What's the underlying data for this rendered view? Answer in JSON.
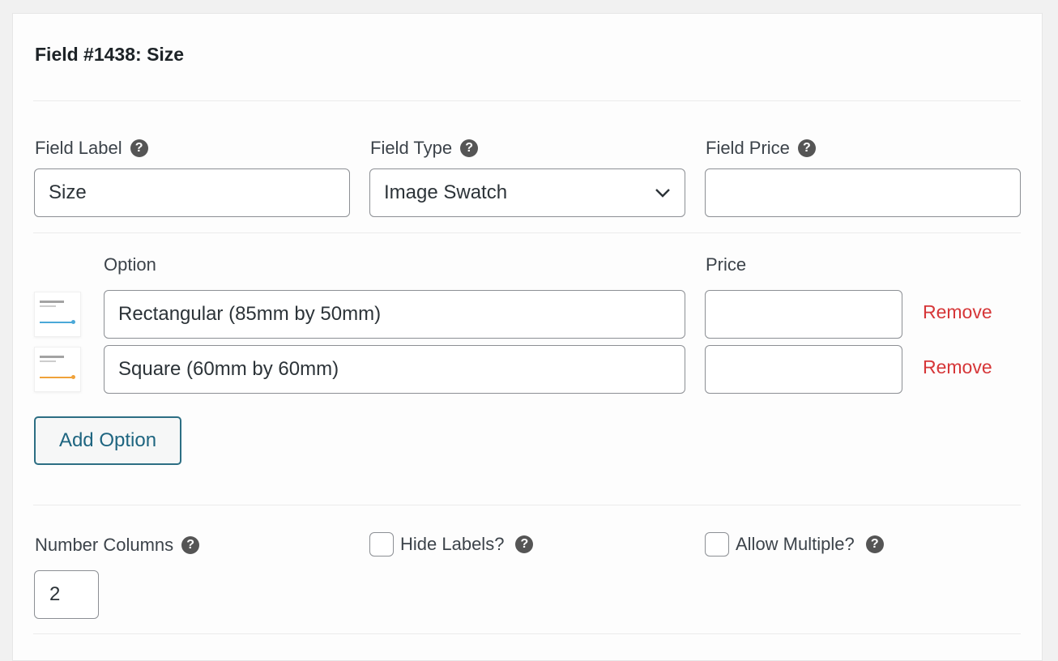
{
  "title": "Field #1438: Size",
  "fields": {
    "label": {
      "label": "Field Label",
      "value": "Size"
    },
    "type": {
      "label": "Field Type",
      "value": "Image Swatch"
    },
    "price": {
      "label": "Field Price",
      "value": ""
    }
  },
  "options": {
    "option_header": "Option",
    "price_header": "Price",
    "rows": [
      {
        "value": "Rectangular (85mm by 50mm)",
        "price": "",
        "remove_label": "Remove",
        "accent": "#4aa8d8"
      },
      {
        "value": "Square (60mm by 60mm)",
        "price": "",
        "remove_label": "Remove",
        "accent": "#f0a23a"
      }
    ],
    "add_label": "Add Option"
  },
  "settings": {
    "columns_label": "Number Columns",
    "columns_value": "2",
    "hide_labels": {
      "label": "Hide Labels?",
      "checked": false
    },
    "allow_multiple": {
      "label": "Allow Multiple?",
      "checked": false
    }
  },
  "help_glyph": "?"
}
